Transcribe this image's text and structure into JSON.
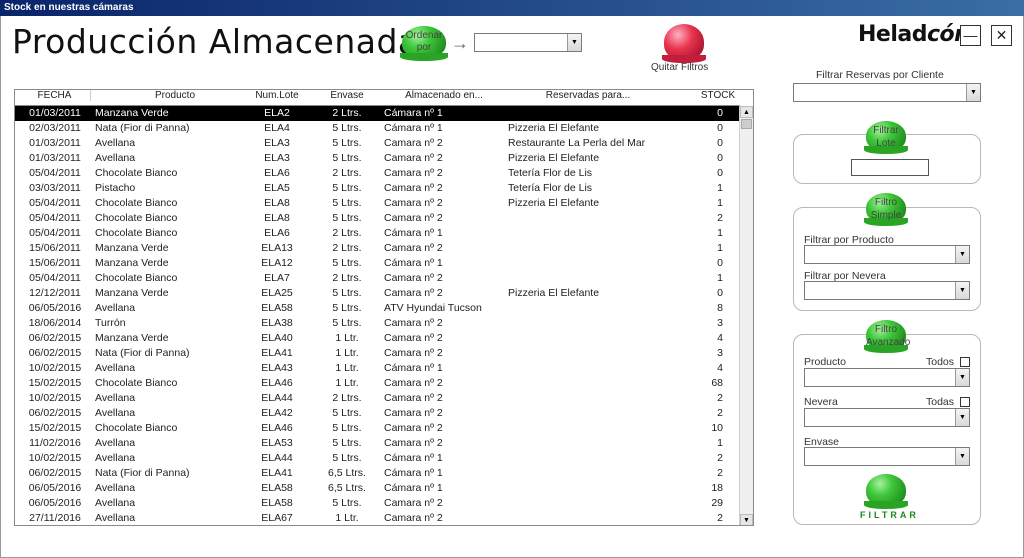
{
  "window": {
    "title": "Stock en nuestras cámaras"
  },
  "header": {
    "page_title": "Producción Almacenada",
    "sort_label_1": "Ordenar",
    "sort_label_2": "por",
    "sort_value": "",
    "clear_filters_label": "Quitar Filtros",
    "brand_part1": "Helad",
    "brand_part2": "cón"
  },
  "window_controls": {
    "minimize": "—",
    "close": "✕"
  },
  "table": {
    "columns": [
      "FECHA",
      "Producto",
      "Num.Lote",
      "Envase",
      "Almacenado en...",
      "Reservadas para...",
      "STOCK"
    ],
    "rows": [
      [
        "01/03/2011",
        "Manzana Verde",
        "ELA2",
        "2 Ltrs.",
        "Cámara nº 1",
        "",
        "0"
      ],
      [
        "02/03/2011",
        "Nata (Fior di Panna)",
        "ELA4",
        "5 Ltrs.",
        "Cámara nº 1",
        "Pizzeria El Elefante",
        "0"
      ],
      [
        "01/03/2011",
        "Avellana",
        "ELA3",
        "5 Ltrs.",
        "Camara nº 2",
        "Restaurante La Perla del Mar",
        "0"
      ],
      [
        "01/03/2011",
        "Avellana",
        "ELA3",
        "5 Ltrs.",
        "Camara nº 2",
        "Pizzeria El Elefante",
        "0"
      ],
      [
        "05/04/2011",
        "Chocolate Bianco",
        "ELA6",
        "2 Ltrs.",
        "Camara nº 2",
        "Tetería Flor de Lis",
        "0"
      ],
      [
        "03/03/2011",
        "Pistacho",
        "ELA5",
        "5 Ltrs.",
        "Camara nº 2",
        "Tetería Flor de Lis",
        "1"
      ],
      [
        "05/04/2011",
        "Chocolate Bianco",
        "ELA8",
        "5 Ltrs.",
        "Camara nº 2",
        "Pizzeria El Elefante",
        "1"
      ],
      [
        "05/04/2011",
        "Chocolate Bianco",
        "ELA8",
        "5 Ltrs.",
        "Camara nº 2",
        "",
        "2"
      ],
      [
        "05/04/2011",
        "Chocolate Bianco",
        "ELA6",
        "2 Ltrs.",
        "Cámara nº 1",
        "",
        "1"
      ],
      [
        "15/06/2011",
        "Manzana Verde",
        "ELA13",
        "2 Ltrs.",
        "Camara nº 2",
        "",
        "1"
      ],
      [
        "15/06/2011",
        "Manzana Verde",
        "ELA12",
        "5 Ltrs.",
        "Cámara nº 1",
        "",
        "0"
      ],
      [
        "05/04/2011",
        "Chocolate Bianco",
        "ELA7",
        "2 Ltrs.",
        "Camara nº 2",
        "",
        "1"
      ],
      [
        "12/12/2011",
        "Manzana Verde",
        "ELA25",
        "5 Ltrs.",
        "Camara nº 2",
        "Pizzeria El Elefante",
        "0"
      ],
      [
        "06/05/2016",
        "Avellana",
        "ELA58",
        "5 Ltrs.",
        "ATV Hyundai Tucson",
        "",
        "8"
      ],
      [
        "18/06/2014",
        "Turrón",
        "ELA38",
        "5 Ltrs.",
        "Camara nº 2",
        "",
        "3"
      ],
      [
        "06/02/2015",
        "Manzana Verde",
        "ELA40",
        "1 Ltr.",
        "Camara nº 2",
        "",
        "4"
      ],
      [
        "06/02/2015",
        "Nata (Fior di Panna)",
        "ELA41",
        "1 Ltr.",
        "Camara nº 2",
        "",
        "3"
      ],
      [
        "10/02/2015",
        "Avellana",
        "ELA43",
        "1 Ltr.",
        "Cámara nº 1",
        "",
        "4"
      ],
      [
        "15/02/2015",
        "Chocolate Bianco",
        "ELA46",
        "1 Ltr.",
        "Camara nº 2",
        "",
        "68"
      ],
      [
        "10/02/2015",
        "Avellana",
        "ELA44",
        "2 Ltrs.",
        "Camara nº 2",
        "",
        "2"
      ],
      [
        "06/02/2015",
        "Avellana",
        "ELA42",
        "5 Ltrs.",
        "Camara nº 2",
        "",
        "2"
      ],
      [
        "15/02/2015",
        "Chocolate Bianco",
        "ELA46",
        "5 Ltrs.",
        "Camara nº 2",
        "",
        "10"
      ],
      [
        "11/02/2016",
        "Avellana",
        "ELA53",
        "5 Ltrs.",
        "Camara nº 2",
        "",
        "1"
      ],
      [
        "10/02/2015",
        "Avellana",
        "ELA44",
        "5 Ltrs.",
        "Cámara nº 1",
        "",
        "2"
      ],
      [
        "06/02/2015",
        "Nata (Fior di Panna)",
        "ELA41",
        "6,5 Ltrs.",
        "Cámara nº 1",
        "",
        "2"
      ],
      [
        "06/05/2016",
        "Avellana",
        "ELA58",
        "6,5 Ltrs.",
        "Cámara nº 1",
        "",
        "18"
      ],
      [
        "06/05/2016",
        "Avellana",
        "ELA58",
        "5 Ltrs.",
        "Camara nº 2",
        "",
        "29"
      ],
      [
        "27/11/2016",
        "Avellana",
        "ELA67",
        "1 Ltr.",
        "Camara nº 2",
        "",
        "2"
      ]
    ],
    "selected_row": 0
  },
  "filters": {
    "client_label": "Filtrar Reservas por Cliente",
    "client_value": "",
    "lote_label_1": "Filtrar",
    "lote_label_2": "Lote",
    "lote_value": "",
    "simple_label_1": "Filtro",
    "simple_label_2": "Simple",
    "simple_product_label": "Filtrar por Producto",
    "simple_product_value": "",
    "simple_fridge_label": "Filtrar por Nevera",
    "simple_fridge_value": "",
    "advanced_label_1": "Filtro",
    "advanced_label_2": "Avanzado",
    "adv_product_label": "Producto",
    "adv_product_all_label": "Todos",
    "adv_product_value": "",
    "adv_fridge_label": "Nevera",
    "adv_fridge_all_label": "Todas",
    "adv_fridge_value": "",
    "adv_container_label": "Envase",
    "adv_container_value": "",
    "apply_label": "FILTRAR"
  },
  "colors": {
    "titlebar": "#0a246a",
    "scoop_green": "#3fc83a",
    "scoop_red": "#e8334f",
    "selected_row": "#000000"
  },
  "icons": {
    "sort": "green-scoop-icon",
    "clear": "red-scoop-icon",
    "arrow": "arrow-right-icon"
  }
}
